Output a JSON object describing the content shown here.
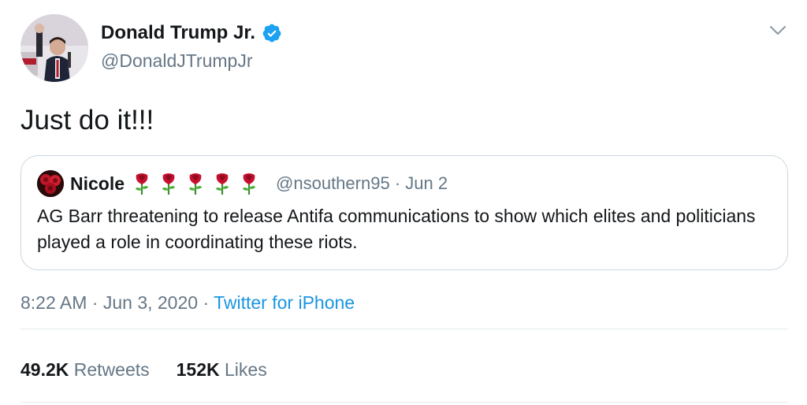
{
  "tweet": {
    "author": {
      "name": "Donald Trump Jr.",
      "handle": "@DonaldJTrumpJr",
      "verified": true
    },
    "text": "Just do it!!!",
    "quoted_tweet": {
      "author_name": "Nicole",
      "name_emojis": [
        "rose",
        "rose",
        "rose",
        "rose",
        "rose"
      ],
      "handle": "@nsouthern95",
      "separator": "·",
      "date": "Jun 2",
      "text": "AG Barr threatening to release Antifa communications to show which elites and politicians played a role in coordinating these riots."
    },
    "meta": {
      "time": "8:22 AM",
      "separator1": "·",
      "date": "Jun 3, 2020",
      "separator2": "·",
      "source": "Twitter for iPhone"
    },
    "stats": {
      "retweets_count": "49.2K",
      "retweets_label": "Retweets",
      "likes_count": "152K",
      "likes_label": "Likes"
    }
  },
  "colors": {
    "text_primary": "#14171a",
    "text_secondary": "#657786",
    "link": "#1b95e0",
    "verified_badge": "#1da1f2",
    "border": "#ccd6dd",
    "divider": "#e6ecf0"
  },
  "icons": {
    "verified": "verified-badge-icon",
    "menu": "chevron-down-icon",
    "emoji": "rose-icon"
  }
}
